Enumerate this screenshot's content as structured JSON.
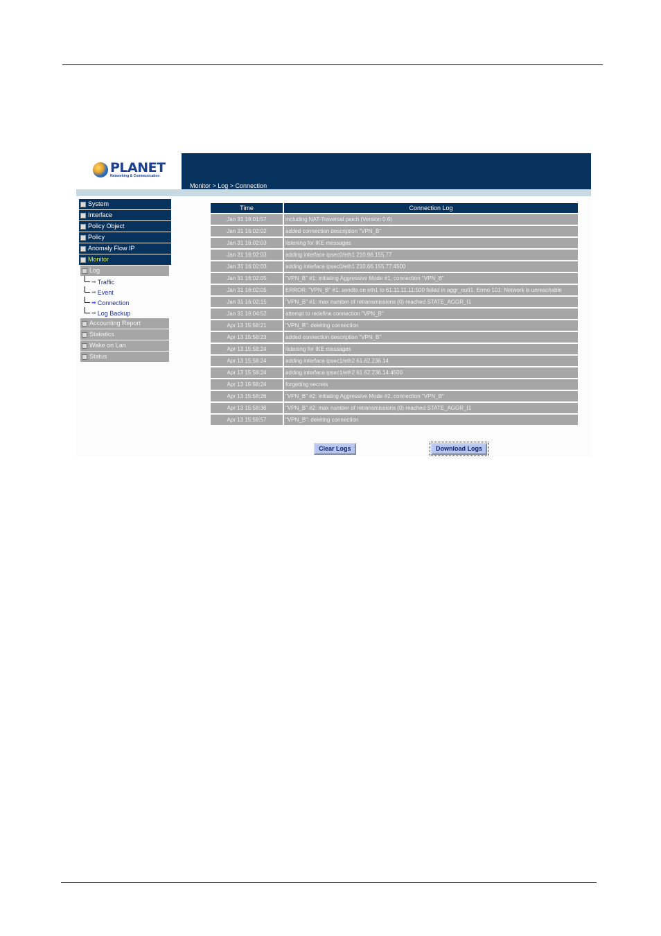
{
  "header": {
    "brand_name": "PLANET",
    "brand_tagline": "Networking & Communication",
    "breadcrumb": "Monitor > Log > Connection"
  },
  "menu": {
    "top_items": [
      {
        "label": "System",
        "state": "collapsed"
      },
      {
        "label": "Interface",
        "state": "collapsed"
      },
      {
        "label": "Policy Object",
        "state": "collapsed"
      },
      {
        "label": "Policy",
        "state": "collapsed"
      },
      {
        "label": "Anomaly Flow IP",
        "state": "collapsed"
      },
      {
        "label": "Monitor",
        "state": "expanded"
      }
    ],
    "log_group": "Log",
    "log_items": [
      "Traffic",
      "Event",
      "Connection",
      "Log Backup"
    ],
    "selected": "Connection",
    "bottom_items": [
      "Accounting Report",
      "Statistics",
      "Wake on Lan",
      "Status"
    ]
  },
  "table": {
    "headers": [
      "Time",
      "Connection Log"
    ],
    "rows": [
      {
        "time": "Jan 31 16:01:57",
        "log": "including NAT-Traversal patch (Version 0.6)"
      },
      {
        "time": "Jan 31 16:02:02",
        "log": "added connection description \"VPN_B\""
      },
      {
        "time": "Jan 31 16:02:03",
        "log": "listening for IKE messages"
      },
      {
        "time": "Jan 31 16:02:03",
        "log": "adding interface ipsec0/eth1 210.66.155.77"
      },
      {
        "time": "Jan 31 16:02:03",
        "log": "adding interface ipsec0/eth1 210.66.155.77:4500"
      },
      {
        "time": "Jan 31 16:02:05",
        "log": "\"VPN_B\" #1: initiating Aggressive Mode #1, connection \"VPN_B\""
      },
      {
        "time": "Jan 31 16:02:05",
        "log": "ERROR: \"VPN_B\" #1: sendto on eth1 to 61.11.11.11:500 failed in aggr_outI1. Errno 101: Network is unreachable"
      },
      {
        "time": "Jan 31 16:02:15",
        "log": "\"VPN_B\" #1: max number of retransmissions (0) reached STATE_AGGR_I1"
      },
      {
        "time": "Jan 31 16:04:52",
        "log": "attempt to redefine connection \"VPN_B\""
      },
      {
        "time": "Apr 13 15:58:21",
        "log": "\"VPN_B\": deleting connection"
      },
      {
        "time": "Apr 13 15:58:23",
        "log": "added connection description \"VPN_B\""
      },
      {
        "time": "Apr 13 15:58:24",
        "log": "listening for IKE messages"
      },
      {
        "time": "Apr 13 15:58:24",
        "log": "adding interface ipsec1/eth2 61.62.236.14"
      },
      {
        "time": "Apr 13 15:58:24",
        "log": "adding interface ipsec1/eth2 61.62.236.14:4500"
      },
      {
        "time": "Apr 13 15:58:24",
        "log": "forgetting secrets"
      },
      {
        "time": "Apr 13 15:58:26",
        "log": "\"VPN_B\" #2: initiating Aggressive Mode #2, connection \"VPN_B\""
      },
      {
        "time": "Apr 13 15:58:36",
        "log": "\"VPN_B\" #2: max number of retransmissions (0) reached STATE_AGGR_I1"
      },
      {
        "time": "Apr 13 15:59:57",
        "log": "\"VPN_B\": deleting connection"
      }
    ]
  },
  "buttons": {
    "clear": "Clear Logs",
    "download": "Download Logs"
  }
}
